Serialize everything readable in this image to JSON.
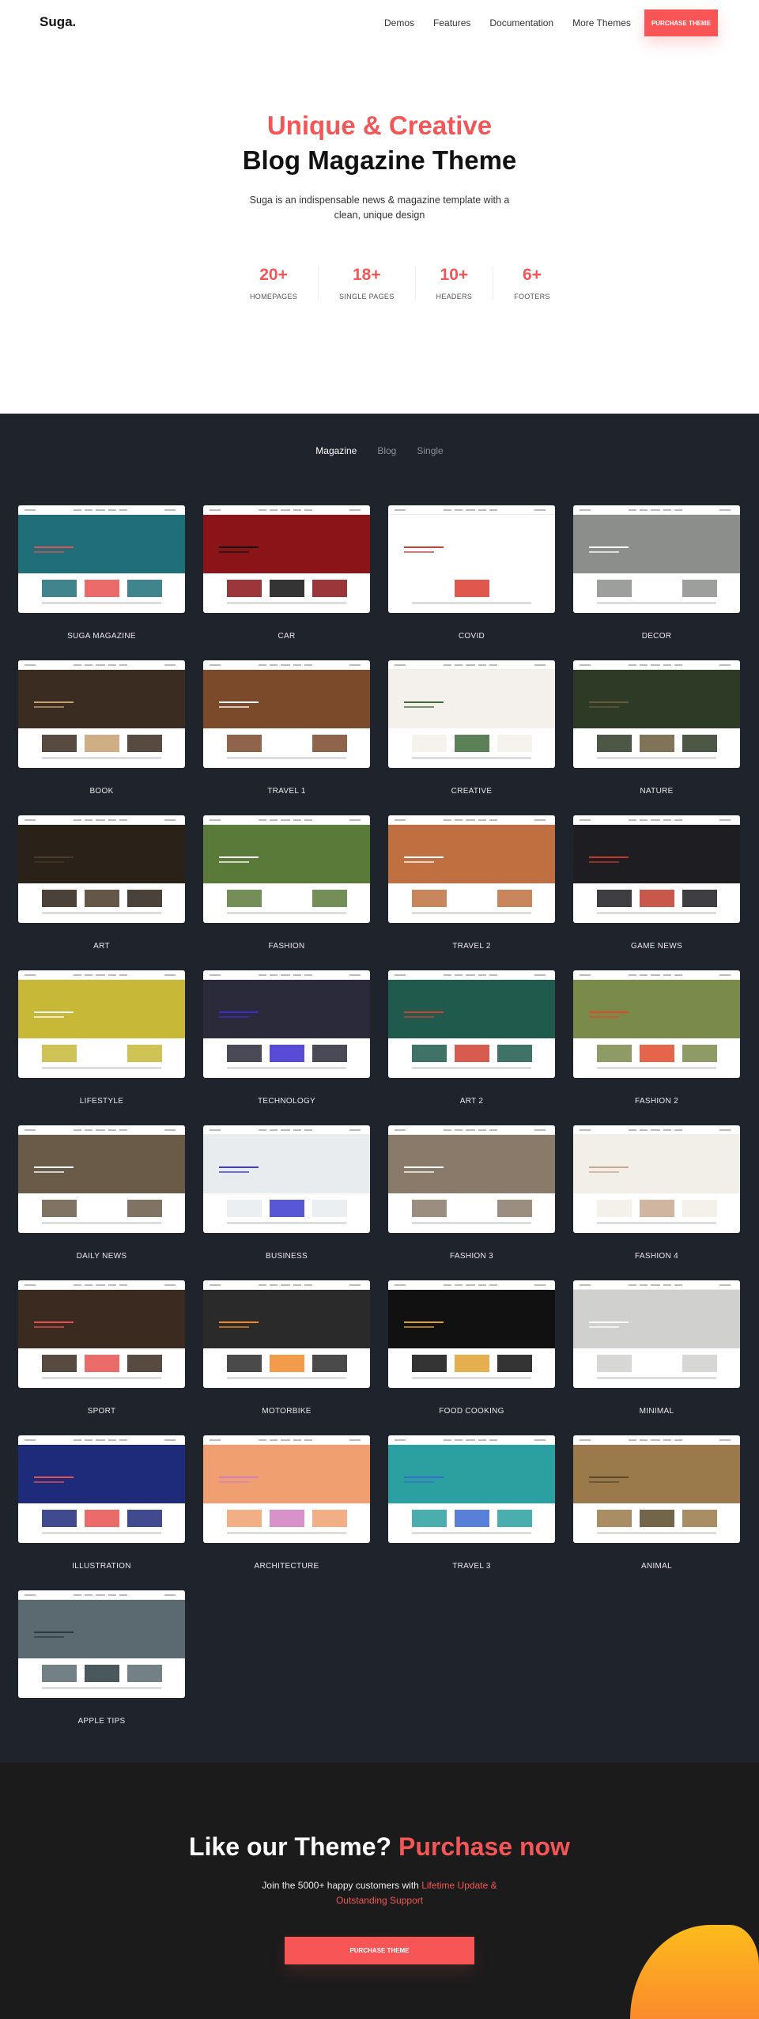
{
  "header": {
    "logo": "Suga.",
    "nav": [
      "Demos",
      "Features",
      "Documentation",
      "More Themes"
    ],
    "purchase_label": "PURCHASE THEME"
  },
  "hero": {
    "title_accent": "Unique & Creative",
    "title_main": "Blog Magazine Theme",
    "description": "Suga is an indispensable news & magazine template with a clean, unique design",
    "stats": [
      {
        "value": "20+",
        "label": "HOMEPAGES"
      },
      {
        "value": "18+",
        "label": "SINGLE PAGES"
      },
      {
        "value": "10+",
        "label": "HEADERS"
      },
      {
        "value": "6+",
        "label": "FOOTERS"
      }
    ]
  },
  "demos_section": {
    "tabs": [
      {
        "label": "Magazine",
        "active": true
      },
      {
        "label": "Blog",
        "active": false
      },
      {
        "label": "Single",
        "active": false
      }
    ],
    "demos": [
      {
        "name": "SUGA MAGAZINE",
        "color": "#1f6f7a",
        "accent": "#e85050"
      },
      {
        "name": "CAR",
        "color": "#8a1418",
        "accent": "#111111"
      },
      {
        "name": "COVID",
        "color": "#ffffff",
        "accent": "#d93a2e"
      },
      {
        "name": "DECOR",
        "color": "#8c8e8c",
        "accent": "#ffffff"
      },
      {
        "name": "BOOK",
        "color": "#3a2c20",
        "accent": "#c8a070"
      },
      {
        "name": "TRAVEL 1",
        "color": "#7a4a2a",
        "accent": "#ffffff"
      },
      {
        "name": "CREATIVE",
        "color": "#f4f1ec",
        "accent": "#3f6a3a"
      },
      {
        "name": "NATURE",
        "color": "#2d3a26",
        "accent": "#6a5a3a"
      },
      {
        "name": "ART",
        "color": "#2a2118",
        "accent": "#4a3a28"
      },
      {
        "name": "FASHION",
        "color": "#5a7a3a",
        "accent": "#ffffff"
      },
      {
        "name": "TRAVEL 2",
        "color": "#c07040",
        "accent": "#ffffff"
      },
      {
        "name": "GAME NEWS",
        "color": "#1d1d22",
        "accent": "#c0392b"
      },
      {
        "name": "LIFESTYLE",
        "color": "#c8b838",
        "accent": "#ffffff"
      },
      {
        "name": "TECHNOLOGY",
        "color": "#2a2a3a",
        "accent": "#3b2dd0"
      },
      {
        "name": "ART 2",
        "color": "#1f5a4c",
        "accent": "#d04030"
      },
      {
        "name": "FASHION 2",
        "color": "#7a8a4a",
        "accent": "#e04a2a"
      },
      {
        "name": "DAILY NEWS",
        "color": "#6a5a48",
        "accent": "#ffffff"
      },
      {
        "name": "BUSINESS",
        "color": "#e8ecef",
        "accent": "#3b3bd0"
      },
      {
        "name": "FASHION 3",
        "color": "#8a7a6a",
        "accent": "#ffffff"
      },
      {
        "name": "FASHION 4",
        "color": "#f2eee8",
        "accent": "#c8a890"
      },
      {
        "name": "SPORT",
        "color": "#3a2a20",
        "accent": "#e85050"
      },
      {
        "name": "MOTORBIKE",
        "color": "#2a2a2a",
        "accent": "#f08a2a"
      },
      {
        "name": "FOOD COOKING",
        "color": "#111111",
        "accent": "#e0a030"
      },
      {
        "name": "MINIMAL",
        "color": "#d0d0ce",
        "accent": "#ffffff"
      },
      {
        "name": "ILLUSTRATION",
        "color": "#1e2a7a",
        "accent": "#e85050"
      },
      {
        "name": "ARCHITECTURE",
        "color": "#f0a070",
        "accent": "#d080c0"
      },
      {
        "name": "TRAVEL 3",
        "color": "#2aa0a0",
        "accent": "#3b6ad0"
      },
      {
        "name": "ANIMAL",
        "color": "#9a7a4a",
        "accent": "#5a4a2a"
      },
      {
        "name": "APPLE TIPS",
        "color": "#5a6a70",
        "accent": "#2a3a40"
      }
    ]
  },
  "footer_cta": {
    "title_main": "Like our Theme?",
    "title_accent": "Purchase now",
    "text_main": "Join the 5000+ happy customers with",
    "text_accent": "Lifetime Update & Outstanding Support",
    "button_label": "PURCHASE THEME"
  },
  "colors": {
    "accent": "#f85656",
    "dark_section": "#1f232b",
    "footer": "#1b1b1b",
    "circle": "#fca324"
  }
}
